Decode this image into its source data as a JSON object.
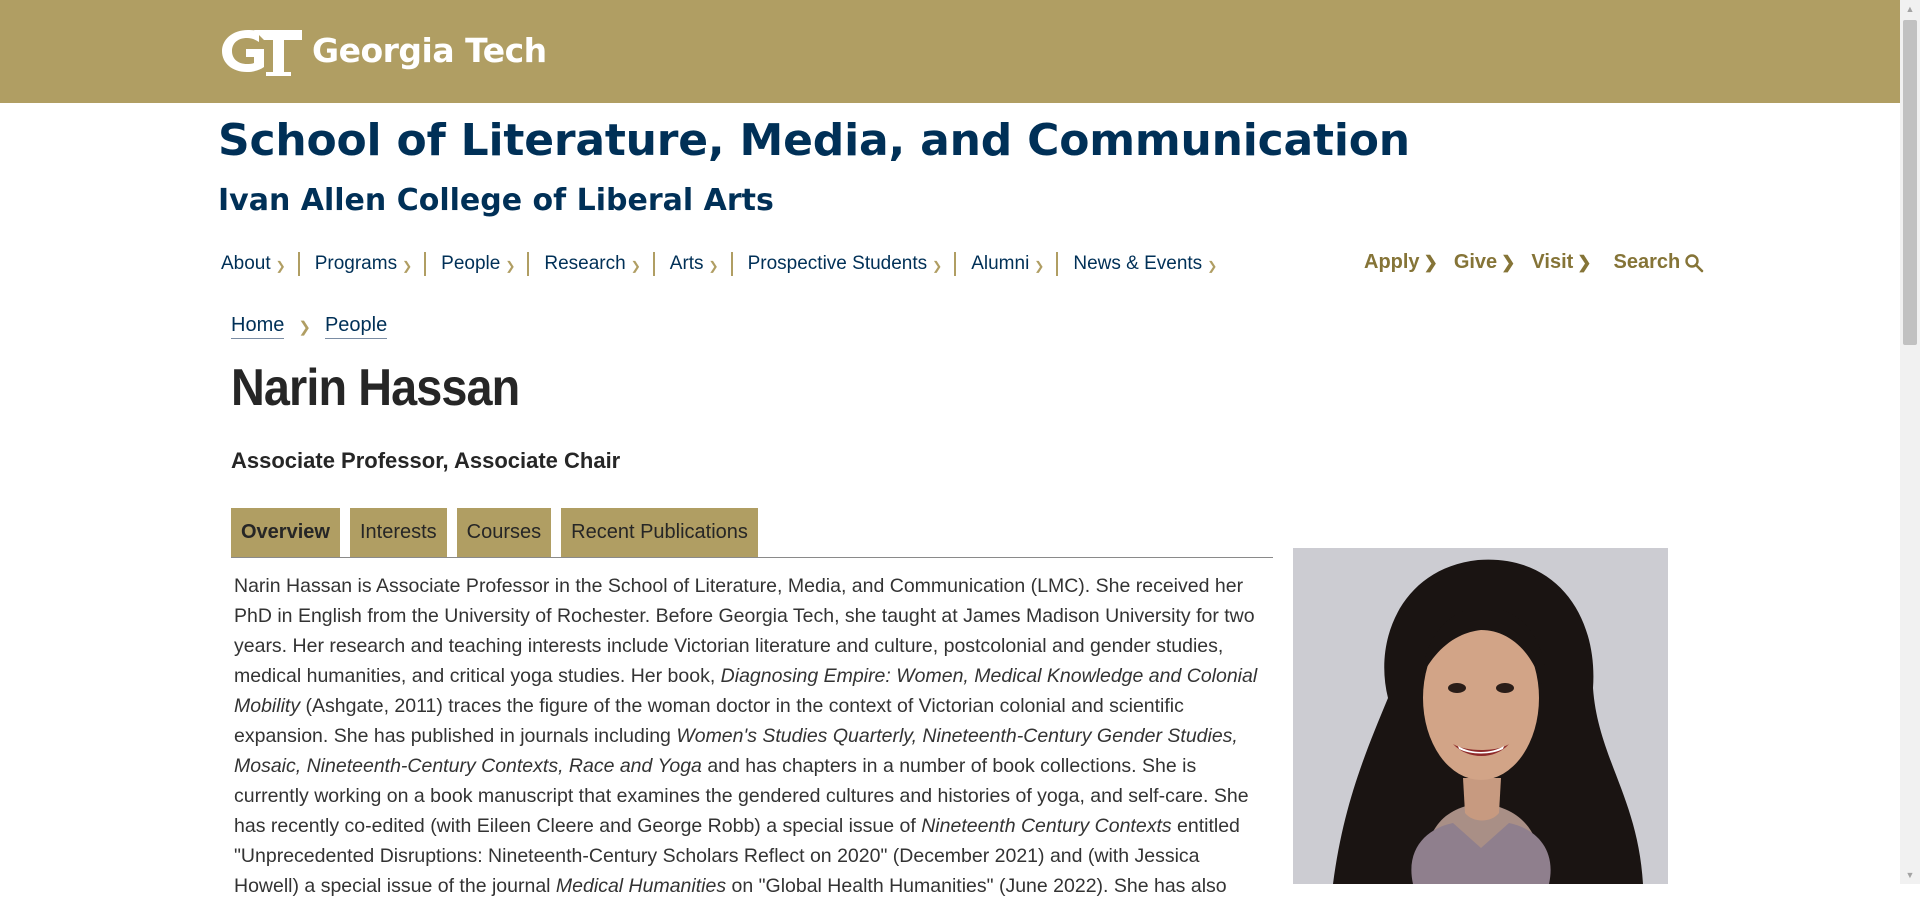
{
  "brand": {
    "logo_text": "Georgia Tech",
    "color_gold": "#b09e63",
    "color_navy": "#003057"
  },
  "header": {
    "site_title": "School of Literature, Media, and Communication",
    "college": "Ivan Allen College of Liberal Arts"
  },
  "nav": {
    "items": [
      {
        "label": "About"
      },
      {
        "label": "Programs"
      },
      {
        "label": "People"
      },
      {
        "label": "Research"
      },
      {
        "label": "Arts"
      },
      {
        "label": "Prospective Students"
      },
      {
        "label": "Alumni"
      },
      {
        "label": "News & Events"
      }
    ],
    "utility": [
      {
        "label": "Apply"
      },
      {
        "label": "Give"
      },
      {
        "label": "Visit"
      }
    ],
    "search_label": "Search"
  },
  "breadcrumb": {
    "home": "Home",
    "people": "People"
  },
  "profile": {
    "name": "Narin Hassan",
    "title": "Associate Professor, Associate Chair",
    "tabs": [
      {
        "label": "Overview",
        "active": true
      },
      {
        "label": "Interests"
      },
      {
        "label": "Courses"
      },
      {
        "label": "Recent Publications"
      }
    ],
    "bio": {
      "p1": "Narin Hassan is Associate Professor in the School of Literature, Media, and Communication (LMC). She received her PhD in English from the University of Rochester. Before Georgia Tech, she taught at James Madison University for two years. Her research and teaching interests include Victorian literature and culture, postcolonial and gender studies, medical humanities, and critical yoga studies. Her book, ",
      "book": "Diagnosing Empire: Women, Medical Knowledge and Colonial Mobility",
      "p2": " (Ashgate, 2011) traces the figure of the woman doctor in the context of Victorian colonial and scientific expansion. She has published in journals including ",
      "journals": "Women's Studies Quarterly, Nineteenth-Century Gender Studies, Mosaic, Nineteenth-Century Contexts, Race and Yoga",
      "p3": " and has chapters in a number of book collections. She is currently working on a book manuscript that examines the gendered cultures and histories of yoga, and self-care. She has recently co-edited (with Eileen Cleere and George Robb) a special issue of ",
      "contexts": "Nineteenth Century Contexts",
      "p4": " entitled \"Unprecedented Disruptions: Nineteenth-Century Scholars Reflect on 2020\" (December 2021) and (with Jessica Howell) a special issue of the journal ",
      "medhum": "Medical Humanities",
      "p5": " on \"Global Health Humanities\" (June 2022). She has also"
    }
  },
  "icons": {
    "search": "search-icon",
    "chevron": "chevron-down-icon",
    "arrow": "chevron-right-icon"
  }
}
